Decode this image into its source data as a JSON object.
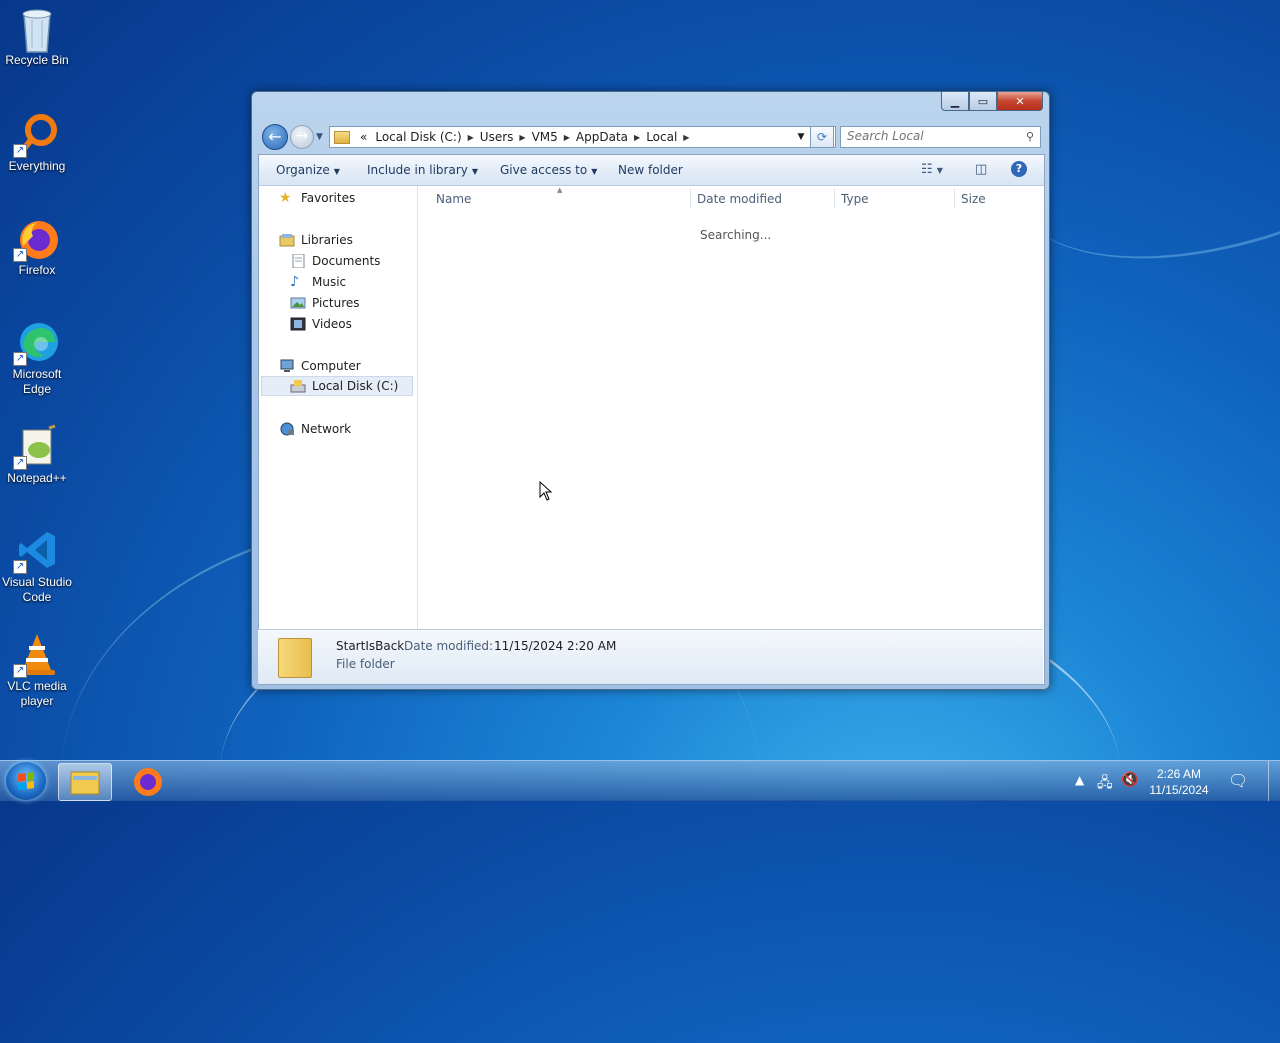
{
  "desktop": {
    "icons": [
      {
        "label": "Recycle Bin"
      },
      {
        "label": "Everything"
      },
      {
        "label": "Firefox"
      },
      {
        "label": "Microsoft Edge"
      },
      {
        "label": "Notepad++"
      },
      {
        "label": "Visual Studio Code"
      },
      {
        "label": "VLC media player"
      }
    ]
  },
  "window": {
    "address": {
      "overflow": "«",
      "crumbs": [
        "Local Disk (C:)",
        "Users",
        "VM5",
        "AppData",
        "Local"
      ]
    },
    "search": {
      "placeholder": "Search Local"
    },
    "toolbar": {
      "organize": "Organize",
      "include_in_library": "Include in library",
      "give_access_to": "Give access to",
      "new_folder": "New folder"
    },
    "nav": {
      "favorites": "Favorites",
      "libraries": "Libraries",
      "documents": "Documents",
      "music": "Music",
      "pictures": "Pictures",
      "videos": "Videos",
      "computer": "Computer",
      "local_disk": "Local Disk (C:)",
      "network": "Network"
    },
    "columns": {
      "name": "Name",
      "date_modified": "Date modified",
      "type": "Type",
      "size": "Size"
    },
    "status_message": "Searching...",
    "details": {
      "name": "StartIsBack",
      "date_label": "Date modified:",
      "date_value": "11/15/2024 2:20 AM",
      "type": "File folder"
    }
  },
  "taskbar": {
    "time": "2:26 AM",
    "date": "11/15/2024"
  }
}
